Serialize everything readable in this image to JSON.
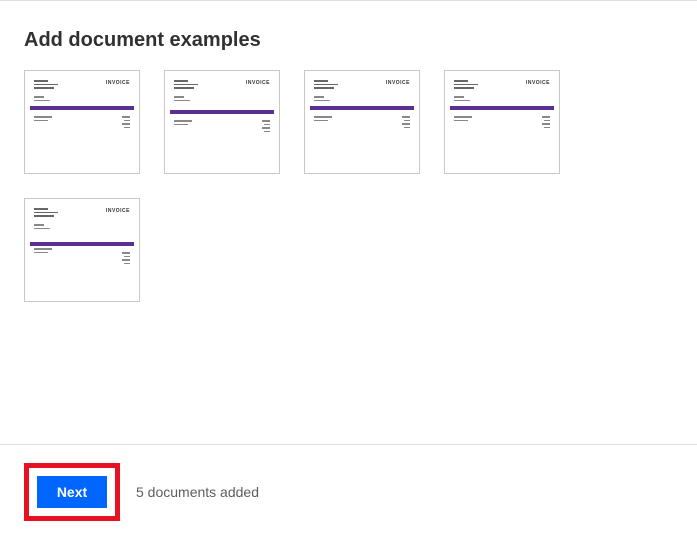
{
  "header": {
    "title": "Add document examples"
  },
  "documents": [
    {
      "label": "INVOICE"
    },
    {
      "label": "INVOICE"
    },
    {
      "label": "INVOICE"
    },
    {
      "label": "INVOICE"
    },
    {
      "label": "INVOICE"
    }
  ],
  "footer": {
    "next_label": "Next",
    "status": "5 documents added"
  }
}
